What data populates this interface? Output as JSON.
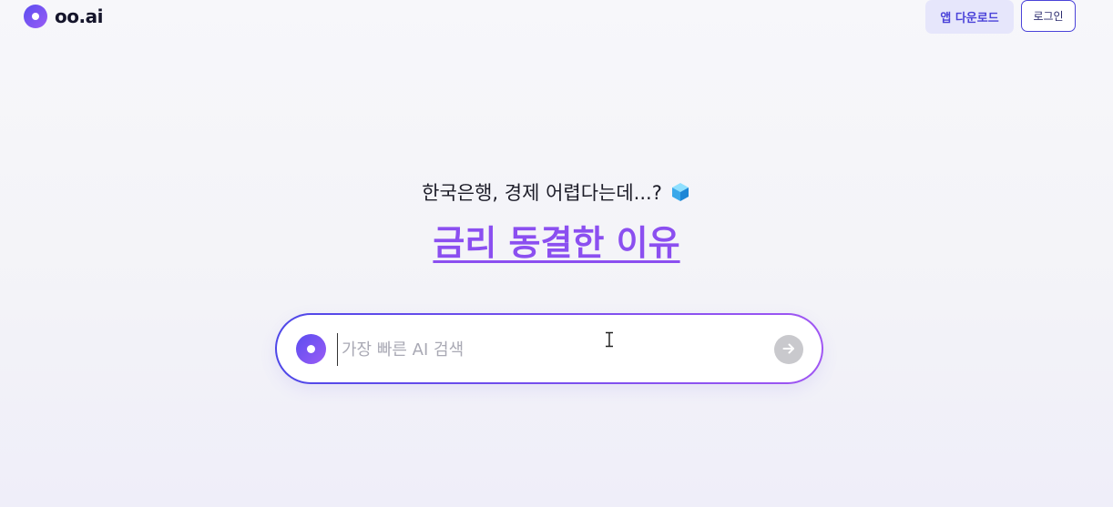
{
  "header": {
    "logo_text": "oo.ai",
    "app_download_label": "앱 다운로드",
    "login_label": "로그인"
  },
  "hero": {
    "subtitle": "한국은행, 경제 어렵다는데...?",
    "subtitle_icon": "cube-icon",
    "title_link": "금리 동결한 이유"
  },
  "search": {
    "placeholder": "가장 빠른 AI 검색",
    "value": "",
    "send_icon": "arrow-right-icon"
  },
  "colors": {
    "accent": "#4b43d9",
    "accent_purple": "#8b4ff0",
    "send_button_disabled": "#c9c9cd"
  }
}
